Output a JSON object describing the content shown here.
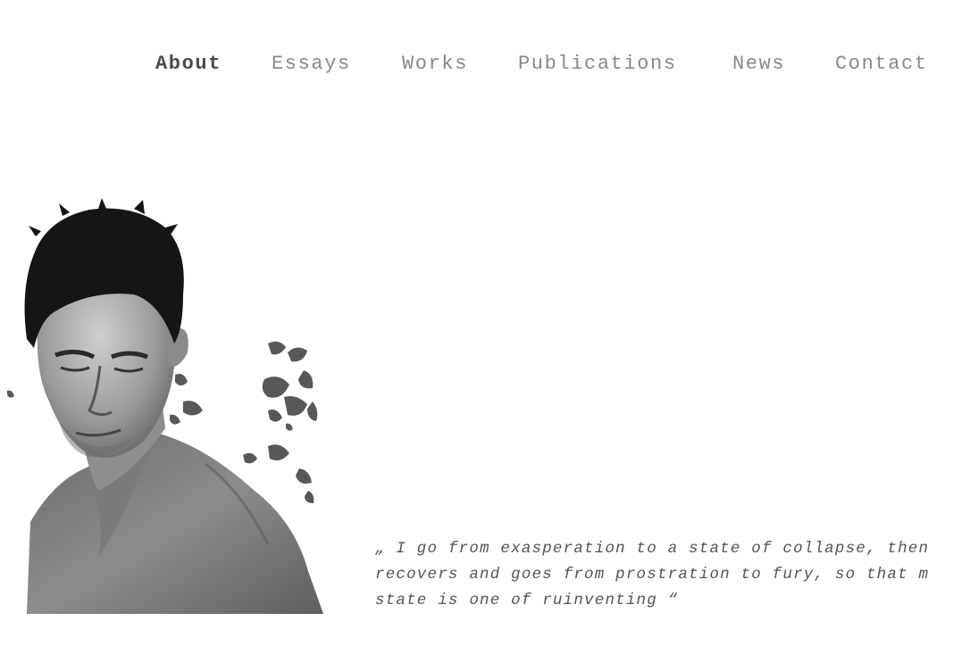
{
  "nav": {
    "items": [
      {
        "label": "About",
        "active": true
      },
      {
        "label": "Essays",
        "active": false
      },
      {
        "label": "Works",
        "active": false
      },
      {
        "label": "Publications",
        "active": false
      },
      {
        "label": "News",
        "active": false
      },
      {
        "label": "Contact",
        "active": false
      }
    ]
  },
  "quote": {
    "lines": [
      "„ I go from exasperation to a state of collapse, then",
      "recovers and goes from prostration to fury, so that m",
      "state is one of ruinventing “"
    ]
  },
  "colors": {
    "nav_active": "#4a4a44",
    "nav_inactive": "#8a8a80",
    "quote_text": "#55554e",
    "background": "#ffffff"
  }
}
